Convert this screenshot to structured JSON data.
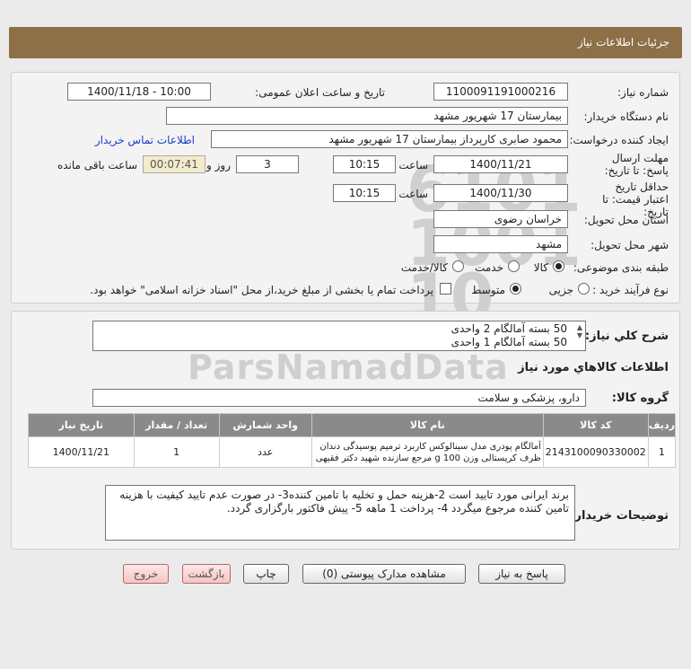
{
  "header": {
    "title": "جزئیات اطلاعات نیاز"
  },
  "form": {
    "need_number_label": "شماره نیاز:",
    "need_number": "1100091191000216",
    "announce_label": "تاریخ و ساعت اعلان عمومی:",
    "announce_value": "1400/11/18 - 10:00",
    "buyer_org_label": "نام دستگاه خریدار:",
    "buyer_org": "بیمارستان 17 شهریور مشهد",
    "creator_label": "ایجاد کننده درخواست:",
    "creator": "محمود صابری کارپرداز بیمارستان 17 شهریور مشهد",
    "contact_link": "اطلاعات تماس خریدار",
    "deadline_label": "مهلت ارسال پاسخ: تا تاریخ:",
    "deadline_date": "1400/11/21",
    "time_label": "ساعت",
    "deadline_time": "10:15",
    "days_value": "3",
    "days_label": "روز و",
    "remaining_time": "00:07:41",
    "remaining_label": "ساعت باقی مانده",
    "validity_label": "حداقل تاریخ اعتبار قیمت: تا تاریخ:",
    "validity_date": "1400/11/30",
    "validity_time": "10:15",
    "province_label": "استان محل تحویل:",
    "province": "خراسان رضوی",
    "city_label": "شهر محل تحویل:",
    "city": "مشهد",
    "category_label": "طبقه بندی موضوعی:",
    "category_options": [
      "کالا",
      "خدمت",
      "کالا/خدمت"
    ],
    "process_label": "نوع فرآیند خرید :",
    "process_options": [
      "جزیی",
      "متوسط"
    ],
    "payment_note": "پرداخت تمام یا بخشی از مبلغ خرید،از محل \"اسناد خزانه اسلامی\" خواهد بود."
  },
  "summary": {
    "label": "شرح کلي نياز:",
    "lines": [
      "50 بسته آمالگام 2 واحدی",
      "50 بسته آمالگام 1 واحدی"
    ]
  },
  "goods": {
    "section_title": "اطلاعات کالاهاي مورد نياز",
    "group_label": "گروه کالا:",
    "group_value": "دارو، پزشکی و سلامت",
    "columns": [
      "ردیف",
      "کد کالا",
      "نام کالا",
      "واحد شمارش",
      "تعداد / مقدار",
      "تاریخ نیاز"
    ],
    "rows": [
      {
        "row": "1",
        "code": "2143100090330002",
        "name": "آمالگام پودری مدل سینالوکس کاربرد ترمیم پوسیدگی دندان ظرف کریستالی وزن 100 g مرجع سازنده شهید دکتر فقیهی",
        "unit": "عدد",
        "qty": "1",
        "date": "1400/11/21"
      }
    ]
  },
  "buyer_notes": {
    "label": "توضیحات خریدار:",
    "text": "برند ایرانی مورد تایید است 2-هزینه حمل و تخلیه با تامین کننده3- در صورت عدم تایید کیفیت با هزینه تامین کننده مرجوع میگردد 4- پرداخت 1 ماهه 5- پیش فاکتور بارگزاری گردد."
  },
  "buttons": {
    "reply": "پاسخ به نیاز",
    "attachments": "مشاهده مدارک پیوستی (0)",
    "print": "چاپ",
    "back": "بازگشت",
    "exit": "خروج"
  },
  "colors": {
    "header": "#8d7048",
    "table_header": "#8a8a8a",
    "link": "#1a3ec8"
  }
}
